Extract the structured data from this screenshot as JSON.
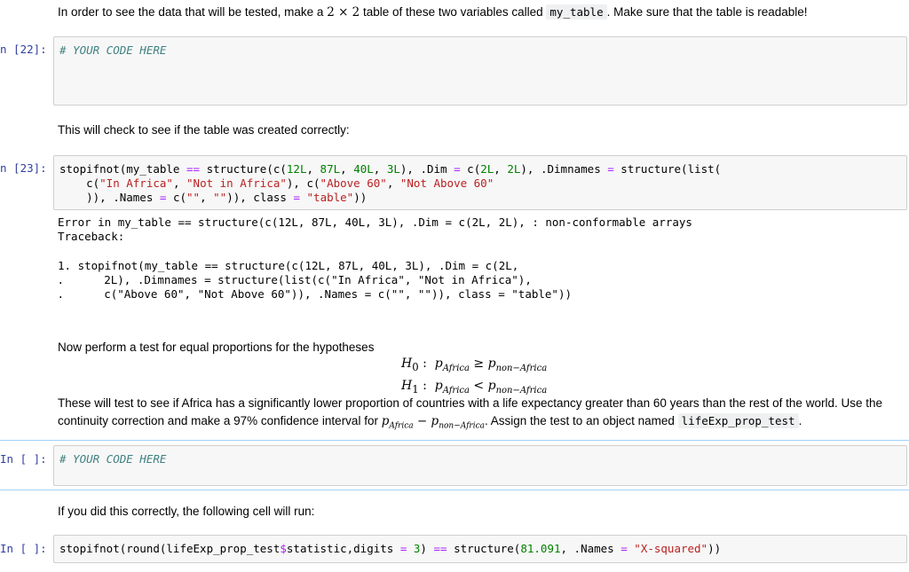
{
  "intro": {
    "before": "In order to see the data that will be tested, make a ",
    "dims": "2 × 2",
    "middle": " table of these two variables called ",
    "varname": "my_table",
    "after": ". Make sure that the table is readable!"
  },
  "cell22": {
    "prompt": "n [22]:",
    "comment": "# YOUR CODE HERE"
  },
  "check_text": "This will check to see if the table was created correctly:",
  "cell23": {
    "prompt": "n [23]:",
    "line1_a": "stopifnot(my_table ",
    "line1_op": "==",
    "line1_b": " structure(c(",
    "n1": "12L",
    "n2": "87L",
    "n3": "40L",
    "n4": "3L",
    "line1_c": "), .Dim ",
    "eq": "=",
    "line1_d": " c(",
    "d1": "2L",
    "d2": "2L",
    "line1_e": "), .Dimnames ",
    "line1_f": " structure(list(",
    "line2_a": "    c(",
    "s1": "\"In Africa\"",
    "s2": "\"Not in Africa\"",
    "line2_b": "), c(",
    "s3": "\"Above 60\"",
    "s4": "\"Not Above 60\"",
    "line3_a": "    )), .Names ",
    "line3_b": " c(",
    "s5": "\"\"",
    "s6": "\"\"",
    "line3_c": ")), class ",
    "s7": "\"table\"",
    "line3_d": "))"
  },
  "error_output": {
    "line1": "Error in my_table == structure(c(12L, 87L, 40L, 3L), .Dim = c(2L, 2L), : non-conformable arrays",
    "line2": "Traceback:",
    "line3": "1. stopifnot(my_table == structure(c(12L, 87L, 40L, 3L), .Dim = c(2L,",
    "line4": " .      2L), .Dimnames = structure(list(c(\"In Africa\", \"Not in Africa\"),",
    "line5": " .      c(\"Above 60\", \"Not Above 60\")), .Names = c(\"\", \"\")), class = \"table\"))"
  },
  "hyp_intro": "Now perform a test for equal proportions for the hypotheses",
  "h0": {
    "label": "H",
    "sub": "0",
    "colon": " :",
    "p": "p",
    "a_sub": "Africa",
    "rel": " ≥ ",
    "p2": "p",
    "b_sub": "non−Africa"
  },
  "h1": {
    "label": "H",
    "sub": "1",
    "colon": " :",
    "p": "p",
    "a_sub": "Africa",
    "rel": " < ",
    "p2": "p",
    "b_sub": "non−Africa"
  },
  "task": {
    "line1": "These will test to see if Africa has a significantly lower proportion of countries with a life expectancy greater than 60 years than the rest of the world. Use the",
    "line2_a": "continuity correction and make a 97% confidence interval for ",
    "p": "p",
    "a_sub": "Africa",
    "minus": " − ",
    "p2": "p",
    "b_sub": "non−Africa",
    "line2_b": ". Assign the test to an object named ",
    "objname": "lifeExp_prop_test",
    "line2_c": "."
  },
  "cell_empty1": {
    "prompt": "In [ ]:",
    "comment": "# YOUR CODE HERE"
  },
  "run_text": "If you did this correctly, the following cell will run:",
  "cell_empty2": {
    "prompt": "In [ ]:",
    "a": "stopifnot(round(lifeExp_prop_test",
    "dollar": "$",
    "b": "statistic,digits ",
    "eq": "=",
    "num": "3",
    "c": ") ",
    "op": "==",
    "d": " structure(",
    "num2": "81.091",
    "e": ", .Names ",
    "str": "\"X-squared\"",
    "f": "))"
  }
}
